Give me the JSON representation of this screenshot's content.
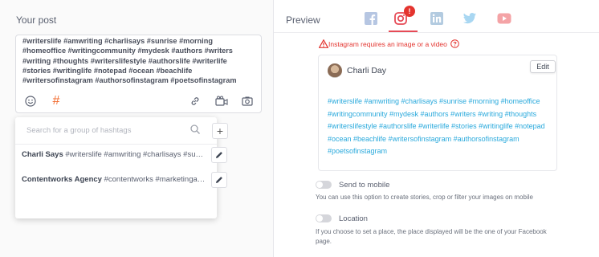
{
  "composer": {
    "title": "Your post",
    "text": "#writerslife #amwriting #charlisays #sunrise #morning #homeoffice #writingcommunity #mydesk #authors #writers #writing #thoughts #writerslifestyle #authorslife #writerlife #stories #writinglife #notepad #ocean #beachlife #writersofinstagram #authorsofinstagram #poetsofinstagram",
    "toolbar": {
      "emoji_icon": "smiley-icon",
      "hashtag_icon": "#",
      "link_icon": "link-icon",
      "video_icon": "video-camera-icon",
      "photo_icon": "camera-icon"
    }
  },
  "hashtag_dropdown": {
    "search_placeholder": "Search for a group of hashtags",
    "add_label": "+",
    "groups": [
      {
        "name": "Charli Says",
        "tags": "#writerslife #amwriting #charlisays #su…"
      },
      {
        "name": "Contentworks Agency",
        "tags": "#contentworks #marketinga…"
      }
    ]
  },
  "preview": {
    "title": "Preview",
    "tabs": [
      {
        "name": "facebook-icon",
        "color": "#b6c6e2"
      },
      {
        "name": "instagram-icon",
        "color": "#e64a56",
        "active": true,
        "badge": "!"
      },
      {
        "name": "linkedin-icon",
        "color": "#b3cbe0"
      },
      {
        "name": "twitter-icon",
        "color": "#a9d7f2"
      },
      {
        "name": "youtube-icon",
        "color": "#f4a3a6"
      }
    ],
    "warning": "Instagram requires an image or a video",
    "card": {
      "author": "Charli Day",
      "edit_label": "Edit",
      "text": "#writerslife #amwriting #charlisays #sunrise #morning #homeoffice #writingcommunity #mydesk #authors #writers #writing #thoughts #writerslifestyle #authorslife #writerlife #stories #writinglife #notepad #ocean #beachlife #writersofinstagram #authorsofinstagram #poetsofinstagram"
    },
    "send_to_mobile": {
      "label": "Send to mobile",
      "help": "You can use this option to create stories, crop or filter your images on mobile"
    },
    "location": {
      "label": "Location",
      "help": "If you choose to set a place, the place displayed will be the one of your Facebook page."
    }
  },
  "colors": {
    "accent": "#e64a56",
    "hashtag_orange": "#f26a2d",
    "link_blue": "#29a9dc",
    "warning_red": "#e3342f"
  }
}
